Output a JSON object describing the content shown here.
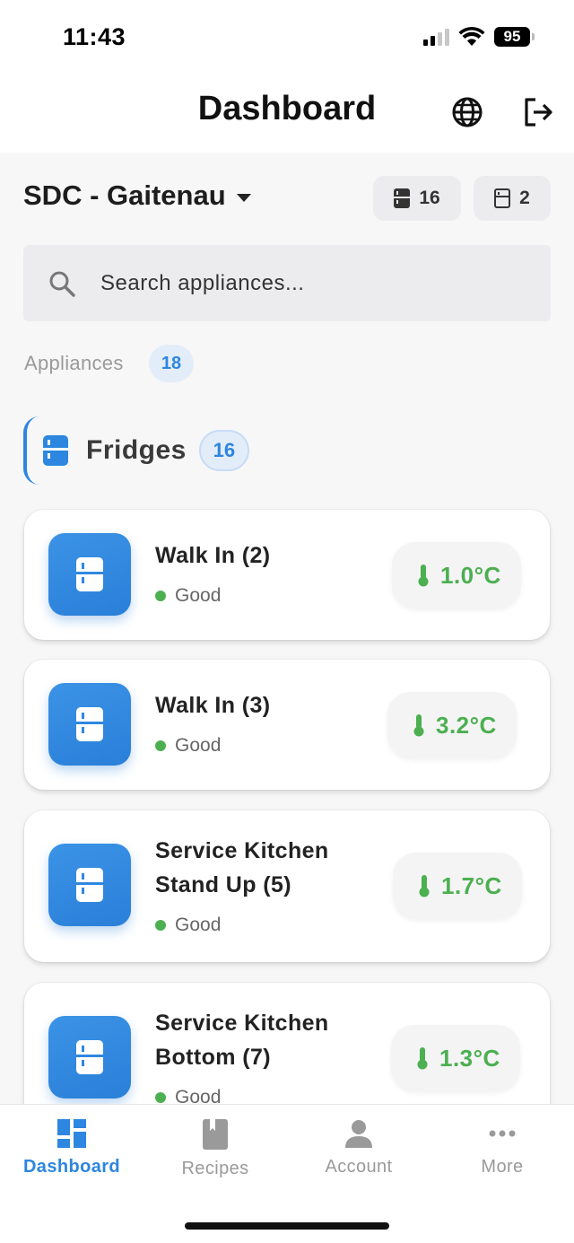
{
  "status_bar": {
    "time": "11:43",
    "battery": "95"
  },
  "header": {
    "title": "Dashboard"
  },
  "location": {
    "name": "SDC - Gaitenau"
  },
  "counts": {
    "fridges": "16",
    "freezers": "2"
  },
  "search": {
    "placeholder": "Search appliances..."
  },
  "appliances": {
    "label": "Appliances",
    "count": "18"
  },
  "section": {
    "title": "Fridges",
    "count": "16"
  },
  "cards": [
    {
      "name": "Walk In (2)",
      "status": "Good",
      "temp": "1.0°C"
    },
    {
      "name": "Walk In (3)",
      "status": "Good",
      "temp": "3.2°C"
    },
    {
      "name_line1": "Service Kitchen",
      "name_line2": "Stand Up (5)",
      "status": "Good",
      "temp": "1.7°C"
    },
    {
      "name_line1": "Service Kitchen",
      "name_line2": "Bottom (7)",
      "status": "Good",
      "temp": "1.3°C"
    }
  ],
  "nav": [
    {
      "label": "Dashboard",
      "active": true
    },
    {
      "label": "Recipes"
    },
    {
      "label": "Account"
    },
    {
      "label": "More"
    }
  ],
  "colors": {
    "accent": "#2d86df",
    "good": "#4caf50"
  }
}
